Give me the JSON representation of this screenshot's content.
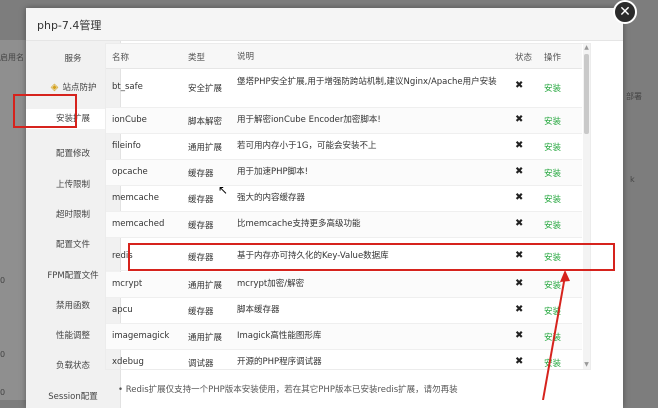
{
  "background": {
    "left_fragments": [
      "启用名",
      "0",
      "0",
      "0"
    ],
    "right_fragments": [
      "部署",
      "k"
    ]
  },
  "dialog": {
    "title": "php-7.4管理",
    "close_icon": "close-icon"
  },
  "sidebar": {
    "items": [
      {
        "label": "服务",
        "icon": ""
      },
      {
        "label": "站点防护",
        "icon": "shield-icon"
      },
      {
        "label": "安装扩展",
        "icon": ""
      },
      {
        "label": "配置修改",
        "icon": ""
      },
      {
        "label": "上传限制",
        "icon": ""
      },
      {
        "label": "超时限制",
        "icon": ""
      },
      {
        "label": "配置文件",
        "icon": ""
      },
      {
        "label": "FPM配置文件",
        "icon": ""
      },
      {
        "label": "禁用函数",
        "icon": ""
      },
      {
        "label": "性能调整",
        "icon": ""
      },
      {
        "label": "负载状态",
        "icon": ""
      },
      {
        "label": "Session配置",
        "icon": ""
      }
    ],
    "active_index": 2
  },
  "table": {
    "headers": {
      "name": "名称",
      "type": "类型",
      "desc": "说明",
      "status": "状态",
      "action": "操作"
    },
    "rows": [
      {
        "name": "bt_safe",
        "type": "安全扩展",
        "desc": "堡塔PHP安全扩展,用于增强防跨站机制,建议Nginx/Apache用户安装",
        "status": "✖",
        "action": "安装"
      },
      {
        "name": "ionCube",
        "type": "脚本解密",
        "desc": "用于解密ionCube Encoder加密脚本!",
        "status": "✖",
        "action": "安装"
      },
      {
        "name": "fileinfo",
        "type": "通用扩展",
        "desc": "若可用内存小于1G，可能会安装不上",
        "status": "✖",
        "action": "安装"
      },
      {
        "name": "opcache",
        "type": "缓存器",
        "desc": "用于加速PHP脚本!",
        "status": "✖",
        "action": "安装"
      },
      {
        "name": "memcache",
        "type": "缓存器",
        "desc": "强大的内容缓存器",
        "status": "✖",
        "action": "安装"
      },
      {
        "name": "memcached",
        "type": "缓存器",
        "desc": "比memcache支持更多高级功能",
        "status": "✖",
        "action": "安装"
      },
      {
        "name": "redis",
        "type": "缓存器",
        "desc": "基于内存亦可持久化的Key-Value数据库",
        "status": "✖",
        "action": "安装"
      },
      {
        "name": "mcrypt",
        "type": "通用扩展",
        "desc": "mcrypt加密/解密",
        "status": "✖",
        "action": "安装"
      },
      {
        "name": "apcu",
        "type": "缓存器",
        "desc": "脚本缓存器",
        "status": "✖",
        "action": "安装"
      },
      {
        "name": "imagemagick",
        "type": "通用扩展",
        "desc": "Imagick高性能图形库",
        "status": "✖",
        "action": "安装"
      },
      {
        "name": "xdebug",
        "type": "调试器",
        "desc": "开源的PHP程序调试器",
        "status": "✖",
        "action": "安装"
      }
    ]
  },
  "note": "Redis扩展仅支持一个PHP版本安装使用，若在其它PHP版本已安装redis扩展，请勿再装",
  "colors": {
    "accent_green": "#20a53a",
    "highlight_red": "#d6231d"
  }
}
